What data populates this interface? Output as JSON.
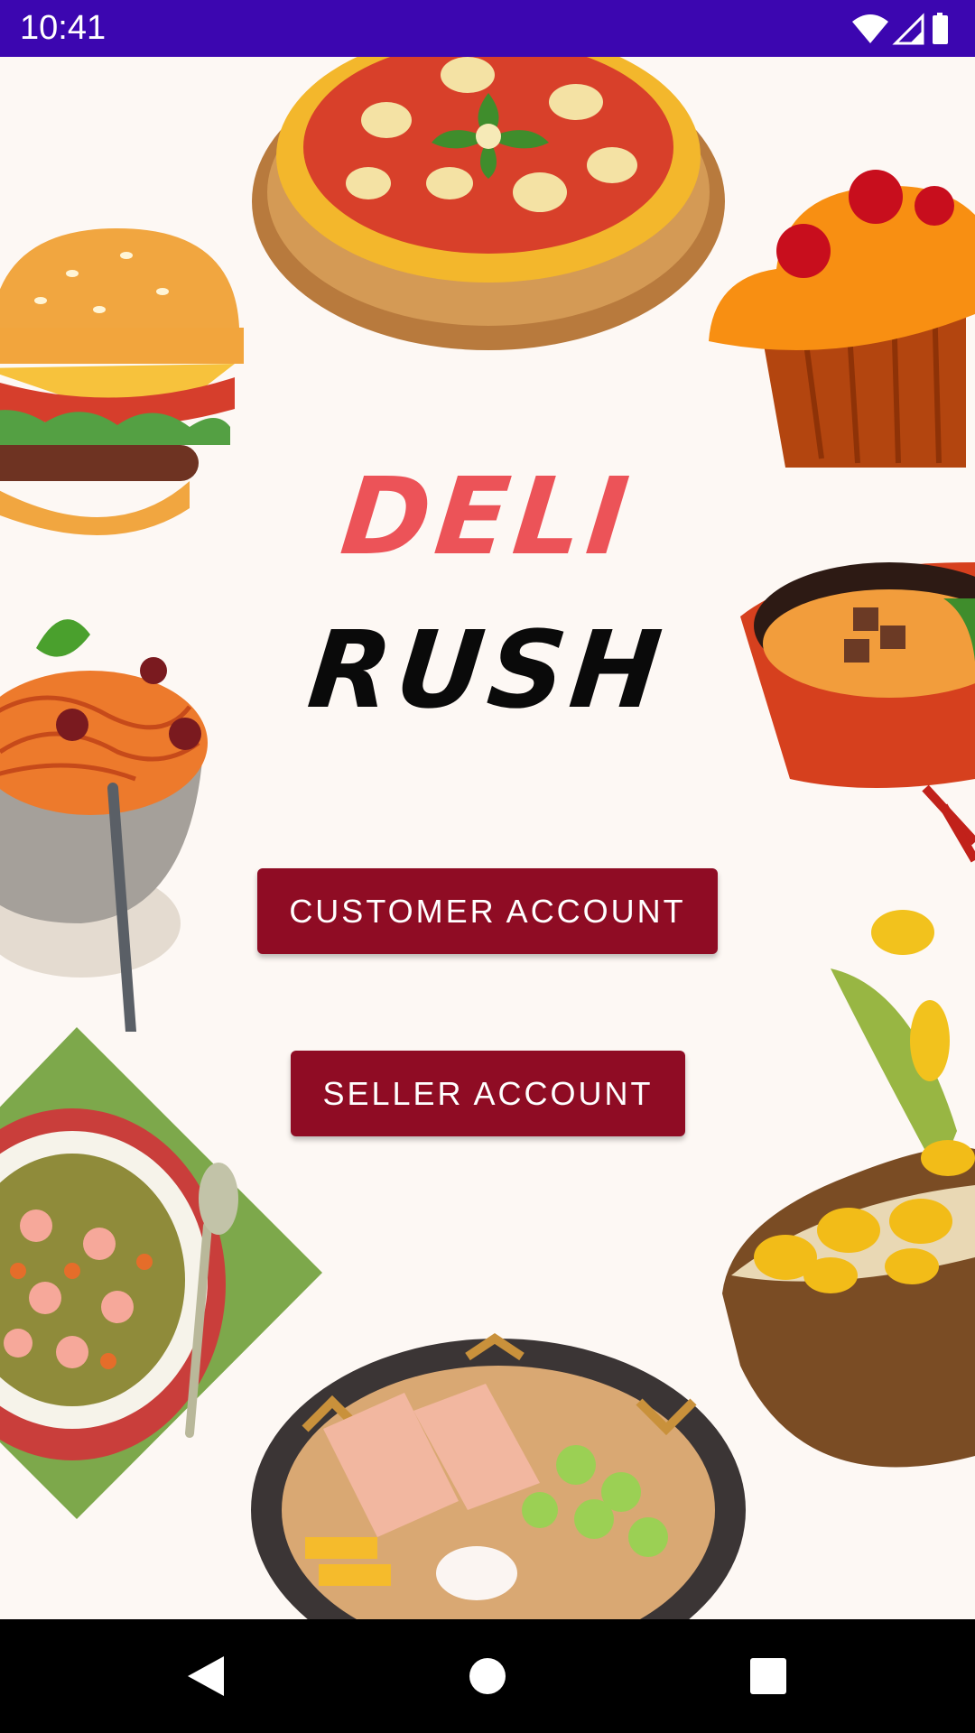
{
  "status_bar": {
    "time": "10:41",
    "icons": [
      "wifi-icon",
      "cellular-signal-icon",
      "battery-icon"
    ],
    "background": "#3c06b0"
  },
  "app": {
    "title_line1": "DELI",
    "title_line2": "RUSH",
    "title_line1_color": "#ec5358",
    "title_line2_color": "#0a0a0a",
    "background": "#fdf8f4"
  },
  "buttons": {
    "customer_label": "CUSTOMER ACCOUNT",
    "seller_label": "SELLER ACCOUNT",
    "color": "#8f0c24"
  },
  "illustrations": [
    "pizza",
    "burger",
    "cupcake",
    "spaghetti",
    "ramen-bowl",
    "banana-dessert",
    "soup",
    "pork-ramen"
  ],
  "nav_bar": {
    "icons": [
      "back-icon",
      "home-icon",
      "recents-icon"
    ]
  }
}
